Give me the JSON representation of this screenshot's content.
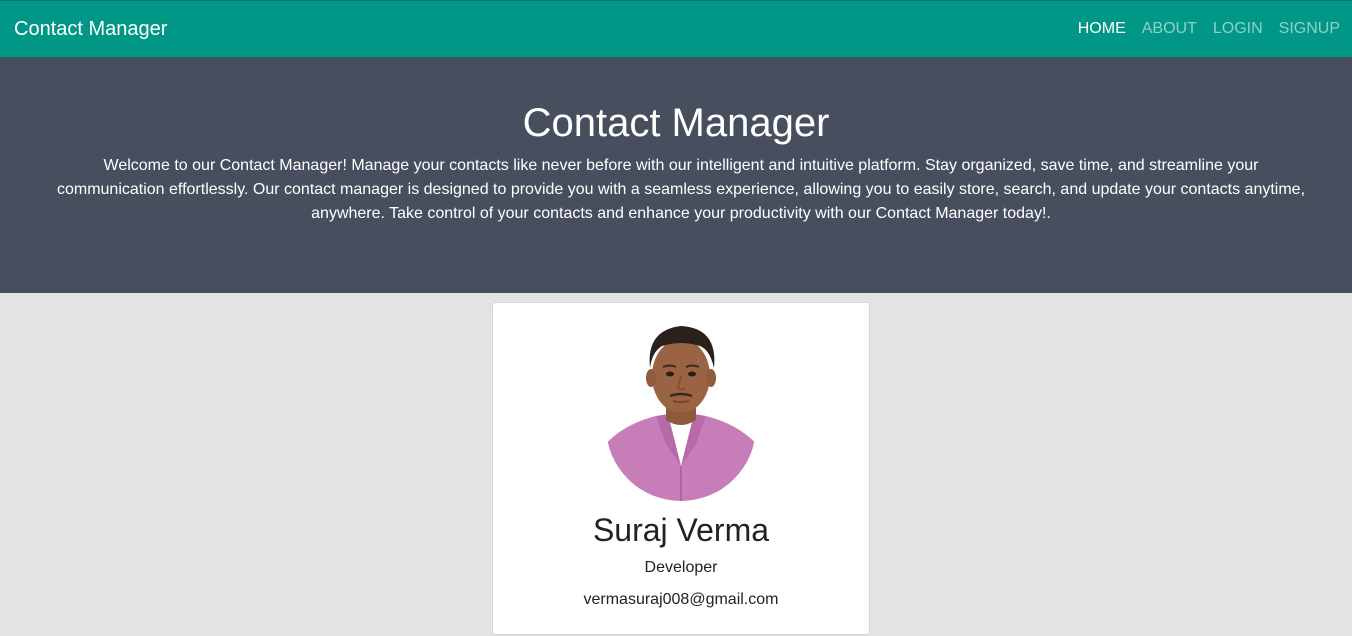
{
  "navbar": {
    "brand": "Contact Manager",
    "links": [
      "HOME",
      "ABOUT",
      "LOGIN",
      "SIGNUP"
    ],
    "active": "HOME",
    "background_color": "#009787"
  },
  "hero": {
    "title": "Contact Manager",
    "text": "Welcome to our Contact Manager! Manage your contacts like never before with our intelligent and intuitive platform. Stay organized, save time, and streamline your communication effortlessly. Our contact manager is designed to provide you with a seamless experience, allowing you to easily store, search, and update your contacts anytime, anywhere. Take control of your contacts and enhance your productivity with our Contact Manager today!.",
    "background_color": "#474e5d"
  },
  "profile_card": {
    "name": "Suraj Verma",
    "role": "Developer",
    "email": "vermasuraj008@gmail.com"
  }
}
